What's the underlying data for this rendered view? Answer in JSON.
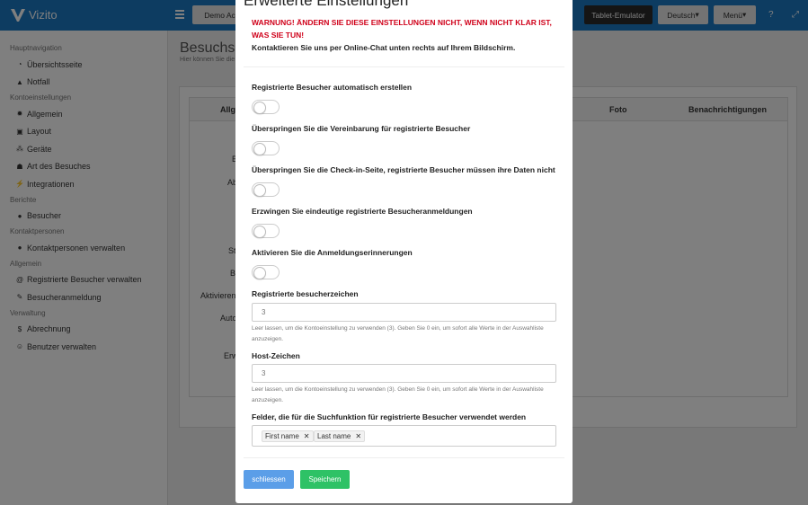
{
  "app": {
    "name": "Vizito"
  },
  "topbar": {
    "demo_label": "Demo Acco",
    "tablet_label": "Tablet-Emulator",
    "language_label": "Deutsch",
    "menu_label": "Menü",
    "help_icon": "question-icon",
    "fullscreen_icon": "expand-icon"
  },
  "sidebar": {
    "sections": [
      {
        "title": "Hauptnavigation",
        "items": [
          {
            "label": "Übersichtsseite",
            "icon": "dashboard-icon"
          },
          {
            "label": "Notfall",
            "icon": "warning-icon"
          }
        ]
      },
      {
        "title": "Kontoeinstellungen",
        "items": [
          {
            "label": "Allgemein",
            "icon": "gear-icon"
          },
          {
            "label": "Layout",
            "icon": "image-icon"
          },
          {
            "label": "Geräte",
            "icon": "devices-icon"
          },
          {
            "label": "Art des Besuches",
            "icon": "users-icon"
          },
          {
            "label": "Integrationen",
            "icon": "plug-icon"
          }
        ]
      },
      {
        "title": "Berichte",
        "items": [
          {
            "label": "Besucher",
            "icon": "user-icon"
          }
        ]
      },
      {
        "title": "Kontaktpersonen",
        "items": [
          {
            "label": "Kontaktpersonen verwalten",
            "icon": "user-icon"
          }
        ]
      },
      {
        "title": "Allgemein",
        "items": [
          {
            "label": "Registrierte Besucher verwalten",
            "icon": "at-icon"
          },
          {
            "label": "Besucheranmeldung",
            "icon": "pencil-icon"
          }
        ]
      },
      {
        "title": "Verwaltung",
        "items": [
          {
            "label": "Abrechnung",
            "icon": "dollar-icon"
          },
          {
            "label": "Benutzer verwalten",
            "icon": "user-plus-icon"
          }
        ]
      }
    ]
  },
  "main": {
    "title": "Besuchsar",
    "subtitle": "Hier können Sie die",
    "table_headers": [
      "Allge",
      "Foto",
      "Benachrichtigungen"
    ],
    "row_labels": [
      "B",
      "Ab",
      "St",
      "B",
      "Aktivieren",
      "Auto",
      "Erw"
    ]
  },
  "modal": {
    "title": "Erweiterte Einstellungen",
    "warning": "WARNUNG! ÄNDERN SIE DIESE EINSTELLUNGEN NICHT, WENN NICHT KLAR IST, WAS SIE TUN!",
    "contact": "Kontaktieren Sie uns per Online-Chat unten rechts auf Ihrem Bildschirm.",
    "toggles": [
      {
        "label": "Registrierte Besucher automatisch erstellen",
        "value": false
      },
      {
        "label": "Überspringen Sie die Vereinbarung für registrierte Besucher",
        "value": false
      },
      {
        "label": "Überspringen Sie die Check-in-Seite, registrierte Besucher müssen ihre Daten nicht best…",
        "value": false
      },
      {
        "label": "Erzwingen Sie eindeutige registrierte Besucheranmeldungen",
        "value": false
      },
      {
        "label": "Aktivieren Sie die Anmeldungserinnerungen",
        "value": false
      }
    ],
    "visitor_chars": {
      "label": "Registrierte besucherzeichen",
      "placeholder": "3",
      "help": "Leer lassen, um die Kontoeinstellung zu verwenden (3). Geben Sie 0 ein, um sofort alle Werte in der Auswahliste anzuzeigen."
    },
    "host_chars": {
      "label": "Host-Zeichen",
      "placeholder": "3",
      "help": "Leer lassen, um die Kontoeinstellung zu verwenden (3). Geben Sie 0 ein, um sofort alle Werte in der Auswahliste anzuzeigen."
    },
    "search_fields": {
      "label": "Felder, die für die Suchfunktion für registrierte Besucher verwendet werden",
      "tags": [
        "First name",
        "Last name"
      ]
    },
    "close_label": "schliessen",
    "save_label": "Speichern"
  },
  "colors": {
    "topbar": "#1a78c2",
    "warning": "#d0021b",
    "close_button": "#5b9ee8",
    "save_button": "#2ec266"
  }
}
